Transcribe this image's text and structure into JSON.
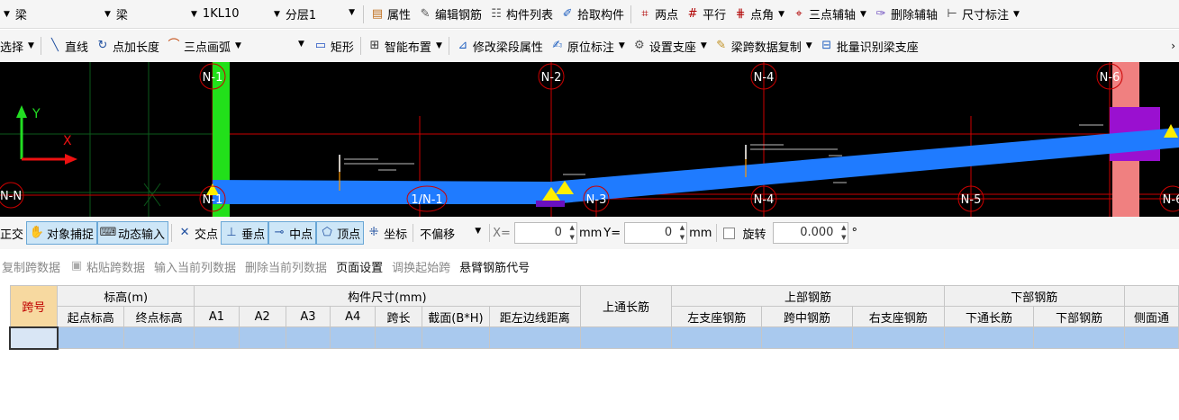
{
  "toolbar1": {
    "dropdown1": "梁",
    "dropdown2": "梁",
    "dropdown3": "1KL10",
    "dropdown4": "分层1",
    "properties": "属性",
    "edit_rebar": "编辑钢筋",
    "component_list": "构件列表",
    "pick_component": "拾取构件",
    "two_points": "两点",
    "parallel": "平行",
    "point_angle": "点角",
    "three_point_axis": "三点辅轴",
    "delete_axis": "删除辅轴",
    "dimension": "尺寸标注"
  },
  "toolbar2": {
    "select": "选择",
    "line": "直线",
    "point_length": "点加长度",
    "three_point_arc": "三点画弧",
    "rectangle": "矩形",
    "smart_layout": "智能布置",
    "modify_span_props": "修改梁段属性",
    "original_annotation": "原位标注",
    "set_support": "设置支座",
    "copy_span_data": "梁跨数据复制",
    "batch_identify": "批量识别梁支座"
  },
  "canvas": {
    "axis_y": "Y",
    "axis_x": "X",
    "labels": [
      "N-1",
      "N-2",
      "N-4",
      "N-6",
      "N-N",
      "N-1",
      "1/N-1",
      "N-3",
      "N-4",
      "N-5",
      "N-6"
    ]
  },
  "snapbar": {
    "ortho": "正交",
    "object_snap": "对象捕捉",
    "dynamic_input": "动态输入",
    "intersection": "交点",
    "perpendicular": "垂点",
    "midpoint": "中点",
    "vertex": "顶点",
    "coordinate": "坐标",
    "offset_mode": "不偏移",
    "x_label": "X=",
    "x_value": "0",
    "unit1": "mm",
    "y_label": "Y=",
    "y_value": "0",
    "unit2": "mm",
    "rotate_label": "旋转",
    "rotate_value": "0.000",
    "degree": "°"
  },
  "actions": {
    "copy_span": "复制跨数据",
    "paste_span": "粘贴跨数据",
    "input_column": "输入当前列数据",
    "delete_column": "删除当前列数据",
    "page_setup": "页面设置",
    "swap_start": "调换起始跨",
    "cantilever_code": "悬臂钢筋代号"
  },
  "table": {
    "span_no": "跨号",
    "elevation": "标高(m)",
    "start_elev": "起点标高",
    "end_elev": "终点标高",
    "dims": "构件尺寸(mm)",
    "a1": "A1",
    "a2": "A2",
    "a3": "A3",
    "a4": "A4",
    "span_len": "跨长",
    "section": "截面(B*H)",
    "dist_left": "距左边线距离",
    "top_through": "上通长筋",
    "top_rebar": "上部钢筋",
    "left_support": "左支座钢筋",
    "mid_span": "跨中钢筋",
    "right_support": "右支座钢筋",
    "bottom_rebar": "下部钢筋",
    "bottom_through": "下通长筋",
    "bottom_rebar2": "下部钢筋",
    "side_through": "侧面通"
  }
}
